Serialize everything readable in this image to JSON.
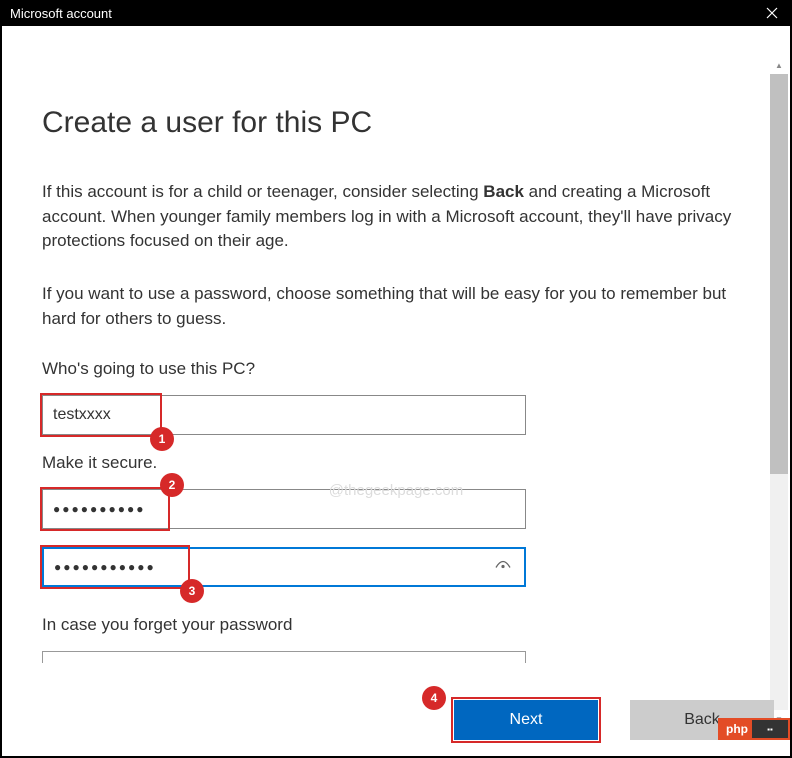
{
  "titlebar": {
    "title": "Microsoft account"
  },
  "page": {
    "heading": "Create a user for this PC",
    "para1_a": "If this account is for a child or teenager, consider selecting ",
    "para1_bold": "Back",
    "para1_b": " and creating a Microsoft account. When younger family members log in with a Microsoft account, they'll have privacy protections focused on their age.",
    "para2": "If you want to use a password, choose something that will be easy for you to remember but hard for others to guess.",
    "label_who": "Who's going to use this PC?",
    "username_value": "testxxxx",
    "label_secure": "Make it secure.",
    "password1_value": "●●●●●●●●●●",
    "password2_value": "●●●●●●●●●●●",
    "label_hint": "In case you forget your password"
  },
  "buttons": {
    "next": "Next",
    "back": "Back"
  },
  "annotations": {
    "b1": "1",
    "b2": "2",
    "b3": "3",
    "b4": "4"
  },
  "watermark": "@thegeekpage.com",
  "overlay": {
    "php": "php"
  }
}
